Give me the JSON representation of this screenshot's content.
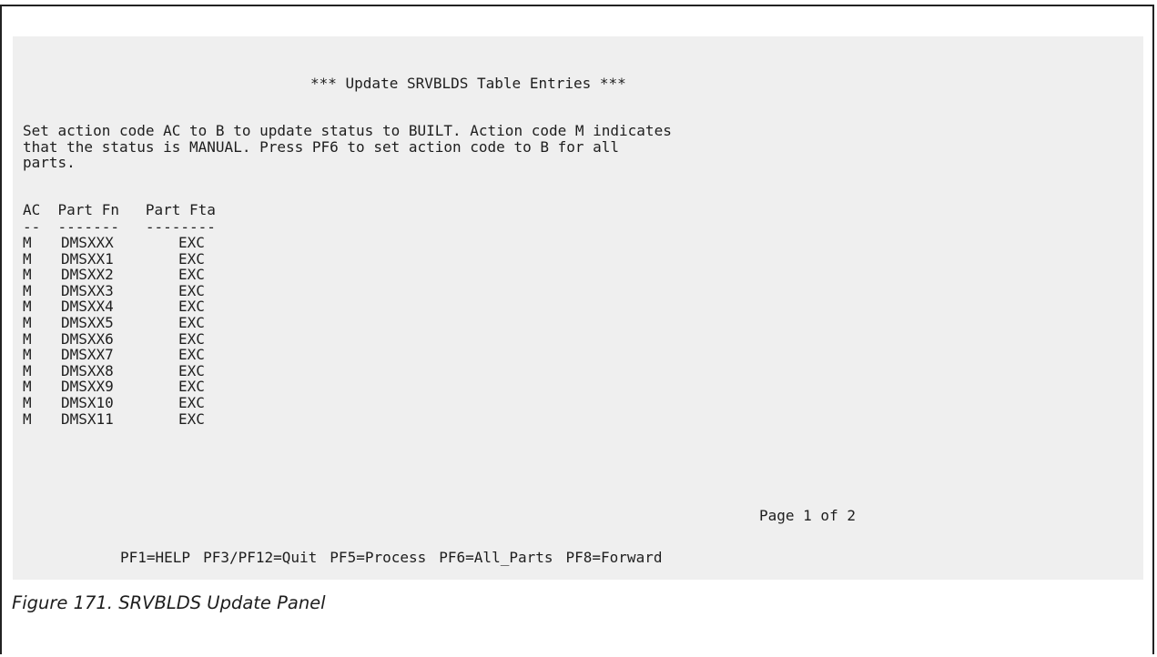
{
  "panel": {
    "title": "*** Update SRVBLDS Table Entries ***",
    "instructions": "Set action code AC to B to update status to BUILT. Action code M indicates\nthat the status is MANUAL. Press PF6 to set action code to B for all\nparts.",
    "columns": {
      "ac": "AC",
      "fn": "Part Fn",
      "fta": "Part Fta"
    },
    "dashes": "--  -------   --------",
    "rows": [
      {
        "ac": "M",
        "fn": "DMSXXX",
        "fta": "EXC"
      },
      {
        "ac": "M",
        "fn": "DMSXX1",
        "fta": "EXC"
      },
      {
        "ac": "M",
        "fn": "DMSXX2",
        "fta": "EXC"
      },
      {
        "ac": "M",
        "fn": "DMSXX3",
        "fta": "EXC"
      },
      {
        "ac": "M",
        "fn": "DMSXX4",
        "fta": "EXC"
      },
      {
        "ac": "M",
        "fn": "DMSXX5",
        "fta": "EXC"
      },
      {
        "ac": "M",
        "fn": "DMSXX6",
        "fta": "EXC"
      },
      {
        "ac": "M",
        "fn": "DMSXX7",
        "fta": "EXC"
      },
      {
        "ac": "M",
        "fn": "DMSXX8",
        "fta": "EXC"
      },
      {
        "ac": "M",
        "fn": "DMSXX9",
        "fta": "EXC"
      },
      {
        "ac": "M",
        "fn": "DMSX10",
        "fta": "EXC"
      },
      {
        "ac": "M",
        "fn": "DMSX11",
        "fta": "EXC"
      }
    ],
    "page_indicator": "Page 1 of 2",
    "pf_keys": [
      "PF1=HELP",
      "PF3/PF12=Quit",
      "PF5=Process",
      "PF6=All_Parts",
      "PF8=Forward"
    ]
  },
  "caption": "Figure 171. SRVBLDS Update Panel"
}
